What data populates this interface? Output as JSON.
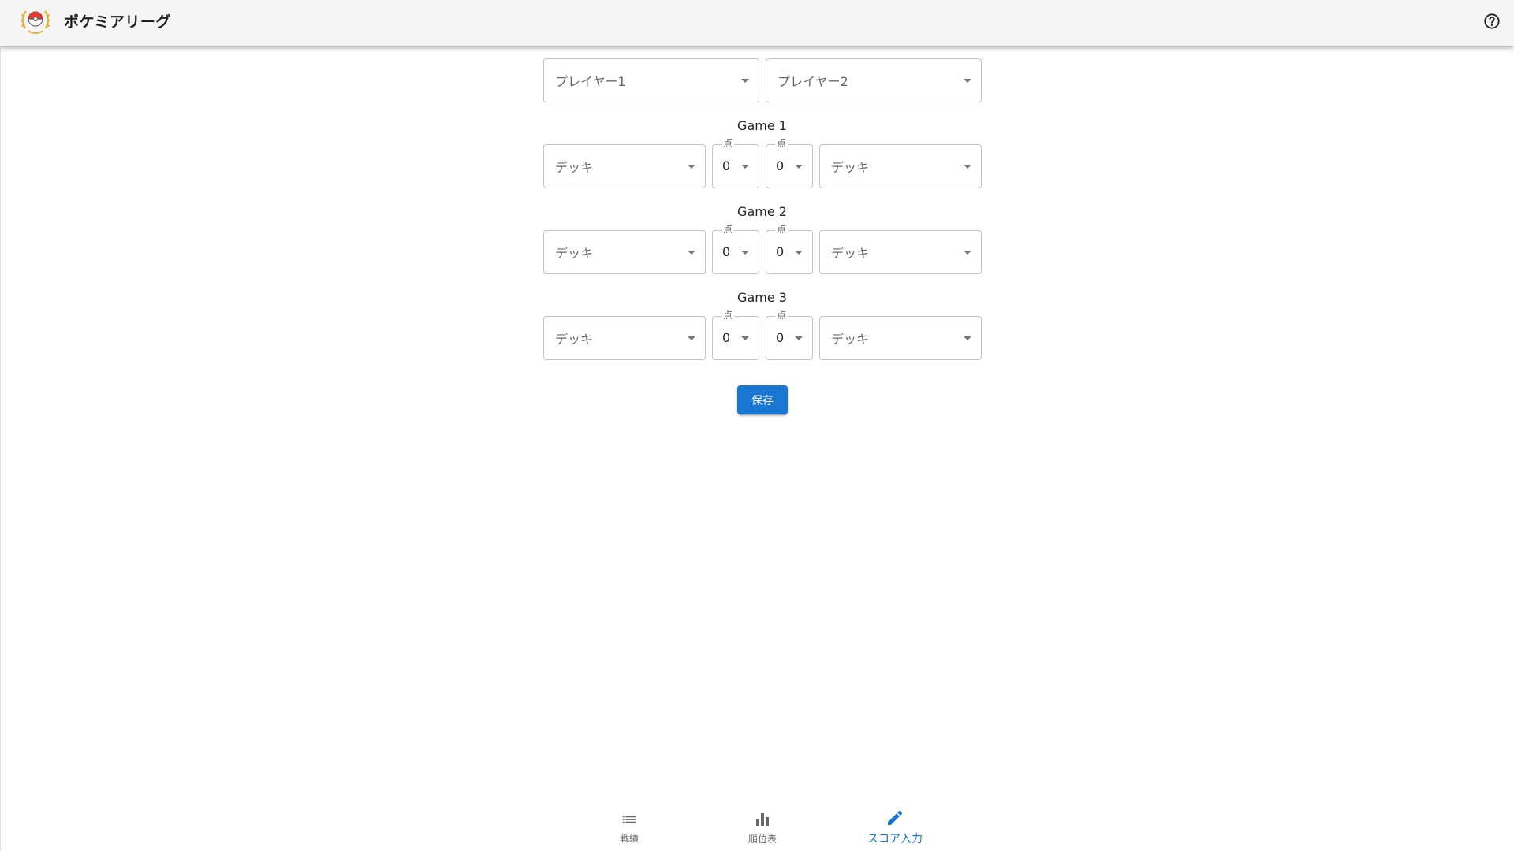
{
  "app": {
    "title": "ポケミアリーグ",
    "logo_icon": "pokeball-laurel-logo",
    "help_icon": "help-circle-icon"
  },
  "players": {
    "player1_placeholder": "プレイヤー1",
    "player2_placeholder": "プレイヤー2"
  },
  "games": [
    {
      "title": "Game 1",
      "deck_left": "デッキ",
      "deck_right": "デッキ",
      "score_label": "点",
      "score_left": "0",
      "score_right": "0"
    },
    {
      "title": "Game 2",
      "deck_left": "デッキ",
      "deck_right": "デッキ",
      "score_label": "点",
      "score_left": "0",
      "score_right": "0"
    },
    {
      "title": "Game 3",
      "deck_left": "デッキ",
      "deck_right": "デッキ",
      "score_label": "点",
      "score_left": "0",
      "score_right": "0"
    }
  ],
  "save_label": "保存",
  "nav": [
    {
      "label": "戦績",
      "icon": "list-icon"
    },
    {
      "label": "順位表",
      "icon": "bar-chart-icon"
    },
    {
      "label": "スコア入力",
      "icon": "pencil-icon",
      "active": true
    }
  ],
  "colors": {
    "primary": "#1976d2",
    "appbar_bg": "#f5f5f5"
  }
}
